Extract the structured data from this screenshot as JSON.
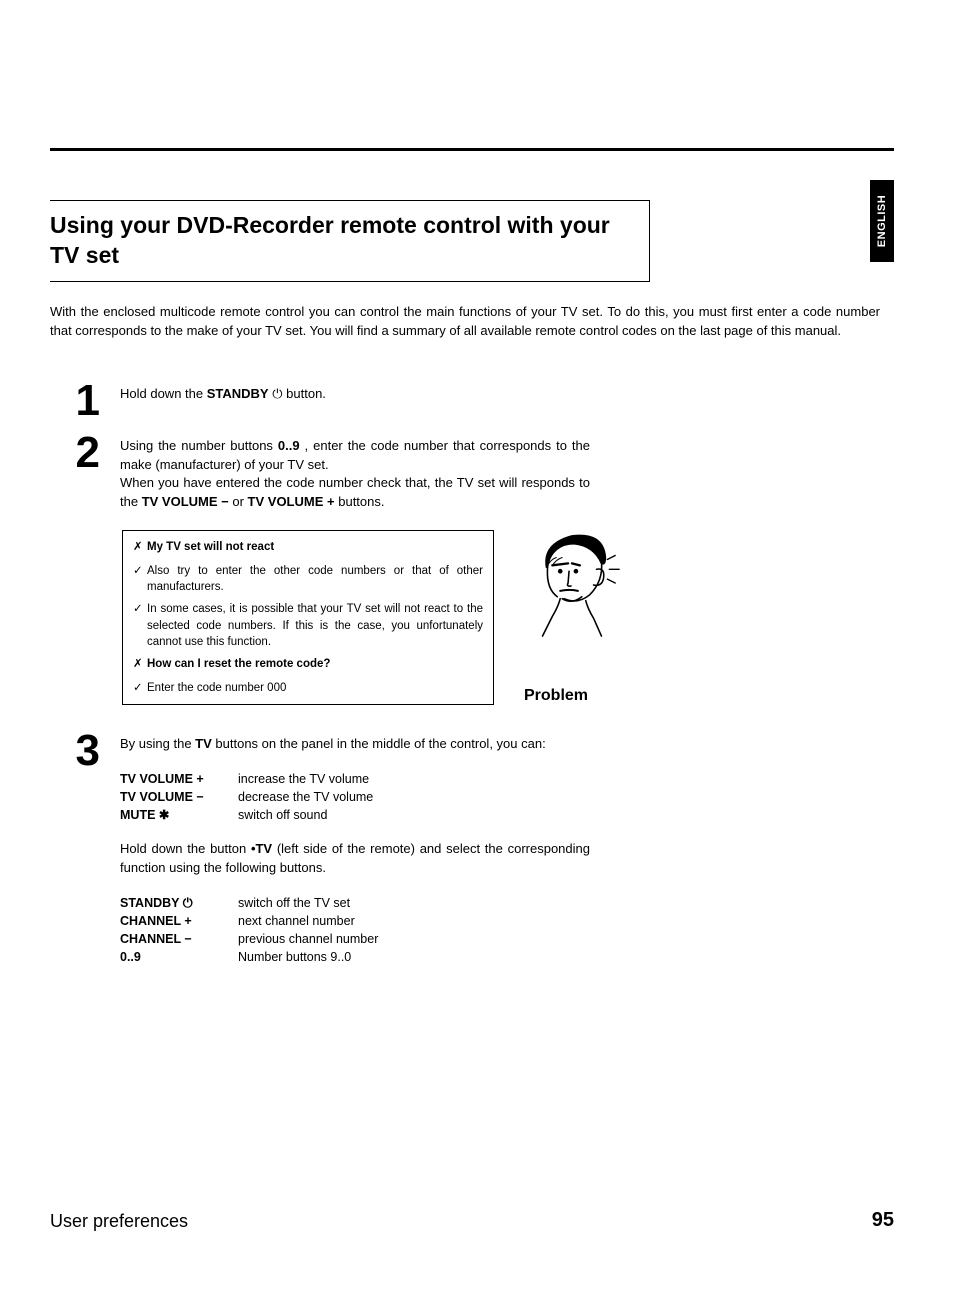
{
  "langTab": "ENGLISH",
  "title": "Using your DVD-Recorder remote control with your TV set",
  "intro": "With the enclosed multicode remote control you can control the main functions of your TV set. To do this, you must first enter a code number that corresponds to the make of your TV set. You will find a summary of all available remote control codes on the last page of this manual.",
  "steps": {
    "s1_num": "1",
    "s1_a": "Hold down the ",
    "s1_standby": "STANDBY",
    "s1_b": " button.",
    "s2_num": "2",
    "s2_a": "Using the number buttons ",
    "s2_btn": "0..9",
    "s2_b": ", enter the code number that corresponds to the make (manufacturer) of your TV set.",
    "s2_c": "When you have entered the code number check that, the TV set will responds to the ",
    "s2_tv": "TV VOLUME",
    "s2_or": " or ",
    "s2_d": " buttons.",
    "s3_num": "3",
    "s3_a": "By using the ",
    "s3_tv": "TV",
    "s3_b": " buttons on the panel in the middle of the control, you can:",
    "tbl1": [
      {
        "k": "TV VOLUME +",
        "v": "increase the TV volume"
      },
      {
        "k": "TV VOLUME −",
        "v": "decrease the TV volume"
      },
      {
        "kpre": "MUTE ",
        "ksym": "mute",
        "v": "switch off sound"
      }
    ],
    "s3_c1": "Hold down the button ",
    "s3_bullet": "•TV",
    "s3_c2": " (left side of the remote) and select the corresponding function using the following buttons.",
    "tbl2": [
      {
        "kpre": "STANDBY ",
        "ksym": "power",
        "v": "switch off the TV set"
      },
      {
        "k": "CHANNEL +",
        "v": "next channel number"
      },
      {
        "k": "CHANNEL −",
        "v": "previous channel number"
      },
      {
        "k": "0..9",
        "v": "Number buttons 9..0"
      }
    ]
  },
  "problem": {
    "h1": "My TV set will not react",
    "i1": "Also try to enter the other code numbers or that of other manufacturers.",
    "i2": "In some cases, it is possible that your TV set will not react to the selected code numbers. If this is the case, you unfortunately cannot use this function.",
    "h2": "How can I reset the remote code?",
    "i3": "Enter the code number 000",
    "label": "Problem"
  },
  "footer": {
    "section": "User preferences",
    "page": "95"
  },
  "glyphs": {
    "x": "✗",
    "check": "✓",
    "power": "⏻",
    "plus": "+",
    "minus": "−",
    "mute": "✱"
  }
}
